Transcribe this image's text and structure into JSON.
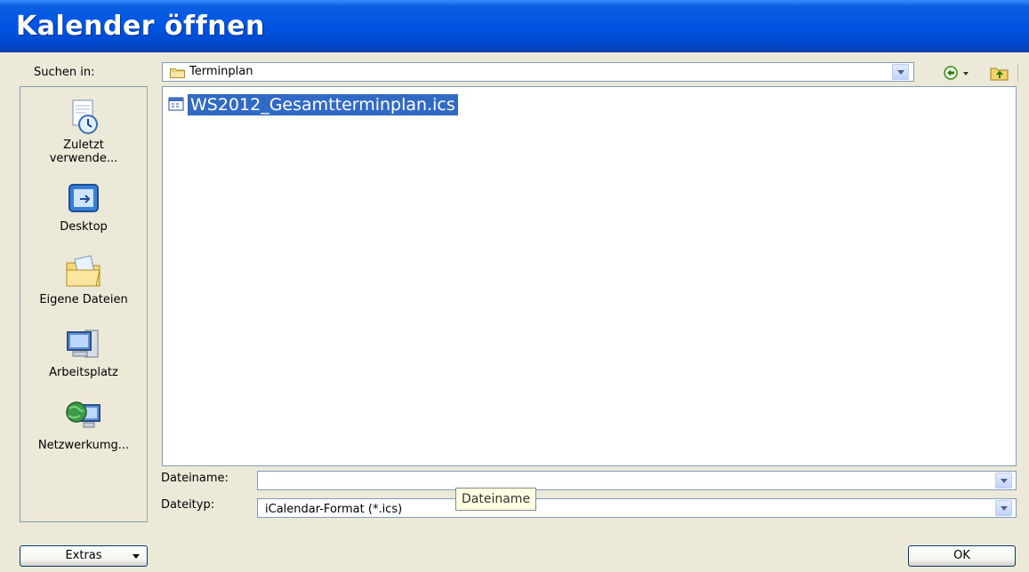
{
  "window": {
    "title": "Kalender öffnen"
  },
  "lookin": {
    "label": "Suchen in:",
    "value": "Terminplan"
  },
  "places": [
    {
      "label": "Zuletzt verwende...",
      "icon": "recent-documents-icon"
    },
    {
      "label": "Desktop",
      "icon": "desktop-icon"
    },
    {
      "label": "Eigene Dateien",
      "icon": "my-documents-icon"
    },
    {
      "label": "Arbeitsplatz",
      "icon": "my-computer-icon"
    },
    {
      "label": "Netzwerkumg...",
      "icon": "network-places-icon"
    }
  ],
  "files": [
    {
      "name": "WS2012_Gesamtterminplan.ics",
      "icon": "calendar-file-icon",
      "selected": true
    }
  ],
  "filename": {
    "label": "Dateiname:",
    "value": ""
  },
  "filetype": {
    "label": "Dateityp:",
    "value": "iCalendar-Format (*.ics)"
  },
  "tooltip": {
    "text": "Dateiname"
  },
  "buttons": {
    "extras": "Extras",
    "ok": "OK"
  },
  "colors": {
    "title_bar": "#0054e3",
    "selection": "#316ac5",
    "dialog_bg": "#ece9d8"
  }
}
